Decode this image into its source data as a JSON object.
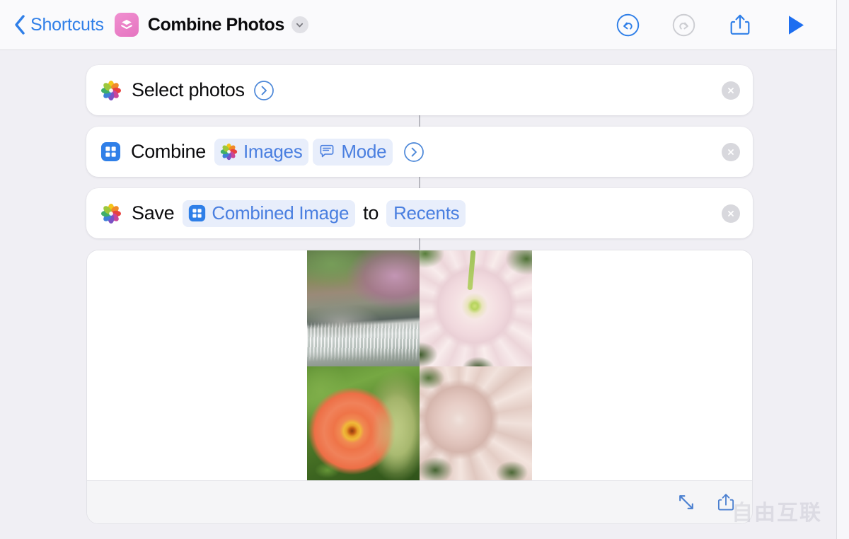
{
  "navbar": {
    "back_icon": "chevron-left-icon",
    "back_label": "Shortcuts",
    "app_icon": "shortcuts-layers-icon",
    "title": "Combine Photos",
    "disclosure_icon": "chevron-down-icon",
    "buttons": [
      {
        "name": "undo-button",
        "icon": "undo-arrow-circle-icon",
        "enabled": true,
        "color": "#2f7fe8"
      },
      {
        "name": "redo-button",
        "icon": "redo-arrow-circle-icon",
        "enabled": false,
        "color": "#c8c8cd"
      },
      {
        "name": "share-button",
        "icon": "share-up-arrow-box-icon",
        "enabled": true,
        "color": "#2f7fe8"
      },
      {
        "name": "run-button",
        "icon": "play-triangle-icon",
        "enabled": true,
        "color": "#1d6ef0"
      }
    ]
  },
  "actions": [
    {
      "id": "select-photos",
      "icon": "photos-pinwheel-icon",
      "text": "Select photos",
      "tokens": [],
      "has_disclosure": true,
      "delete_icon": "close-x-icon"
    },
    {
      "id": "combine-images",
      "icon": "grid-square-blue-icon",
      "text": "Combine",
      "tokens": [
        {
          "label": "Images",
          "icon": "photos-pinwheel-icon"
        },
        {
          "label": "Mode",
          "icon": "speech-bubble-icon"
        }
      ],
      "has_disclosure": true,
      "delete_icon": "close-x-icon"
    },
    {
      "id": "save-to-photo-album",
      "icon": "photos-pinwheel-icon",
      "text": "Save",
      "tokens": [
        {
          "label": "Combined Image",
          "icon": "grid-square-blue-icon"
        }
      ],
      "connector_word": "to",
      "tokens_after": [
        {
          "label": "Recents",
          "icon": null
        }
      ],
      "has_disclosure": false,
      "delete_icon": "close-x-icon"
    }
  ],
  "preview": {
    "photos": [
      {
        "name": "photo-waterfall-garden",
        "alt": "Waterfall in a garden with purple maple foliage"
      },
      {
        "name": "photo-pale-pink-dahlia",
        "alt": "Pale pink and cream dahlia blossom with green leaves"
      },
      {
        "name": "photo-orange-zinnia",
        "alt": "Orange zinnia flower among green leaves"
      },
      {
        "name": "photo-pink-dahlia-cluster",
        "alt": "Pink dahlia cluster in a garden with blue sky"
      }
    ],
    "footer_buttons": [
      {
        "name": "expand-preview-button",
        "icon": "expand-diagonal-arrows-icon"
      },
      {
        "name": "share-preview-button",
        "icon": "share-up-arrow-box-icon"
      }
    ]
  },
  "watermark": {
    "text": "自由互联"
  },
  "colors": {
    "background": "#f0eff4",
    "navbar_background": "#fafafc",
    "card_background": "#ffffff",
    "accent_blue": "#2f7fe8",
    "token_blue_text": "#4a7fe0",
    "token_blue_bg": "#e8eefb",
    "shortcut_pink": "#e574c0",
    "disabled_gray": "#c8c8cd",
    "delete_gray": "#d8d8dd"
  }
}
